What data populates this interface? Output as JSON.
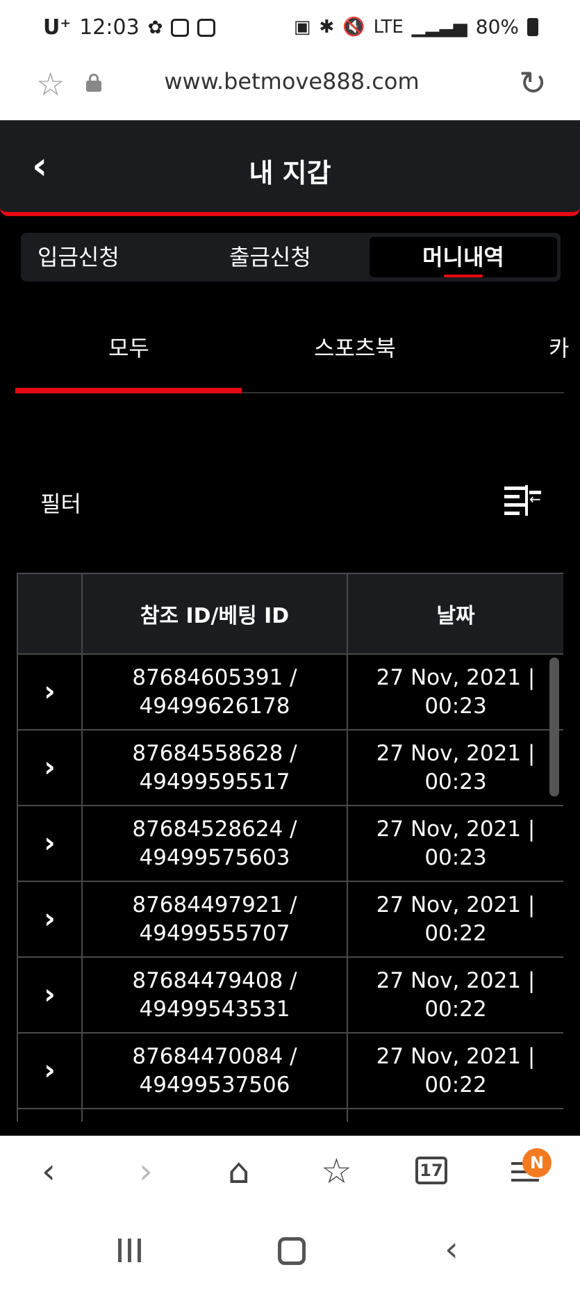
{
  "status_bar": {
    "carrier": "U⁺",
    "time": "12:03",
    "network": "LTE",
    "battery": "80%"
  },
  "browser": {
    "url": "www.betmove888.com"
  },
  "header": {
    "title": "내 지갑"
  },
  "main_tabs": [
    {
      "label": "입금신청"
    },
    {
      "label": "출금신청"
    },
    {
      "label": "머니내역"
    }
  ],
  "sub_tabs": [
    {
      "label": "모두"
    },
    {
      "label": "스포츠북"
    },
    {
      "label": "카"
    }
  ],
  "filter": {
    "label": "필터"
  },
  "table": {
    "headers": [
      "",
      "참조 ID/베팅 ID",
      "날짜"
    ],
    "rows": [
      {
        "ref_id": "87684605391 /",
        "bet_id": "49499626178",
        "date": "27 Nov, 2021 |",
        "time": "00:23"
      },
      {
        "ref_id": "87684558628 /",
        "bet_id": "49499595517",
        "date": "27 Nov, 2021 |",
        "time": "00:23"
      },
      {
        "ref_id": "87684528624 /",
        "bet_id": "49499575603",
        "date": "27 Nov, 2021 |",
        "time": "00:23"
      },
      {
        "ref_id": "87684497921 /",
        "bet_id": "49499555707",
        "date": "27 Nov, 2021 |",
        "time": "00:22"
      },
      {
        "ref_id": "87684479408 /",
        "bet_id": "49499543531",
        "date": "27 Nov, 2021 |",
        "time": "00:22"
      },
      {
        "ref_id": "87684470084 /",
        "bet_id": "49499537506",
        "date": "27 Nov, 2021 |",
        "time": "00:22"
      }
    ]
  },
  "bottom_nav": {
    "tab_count": "17",
    "notification_badge": "N"
  },
  "colors": {
    "accent": "#e50914",
    "header_bg": "#1b1c20",
    "badge": "#f47a20"
  }
}
